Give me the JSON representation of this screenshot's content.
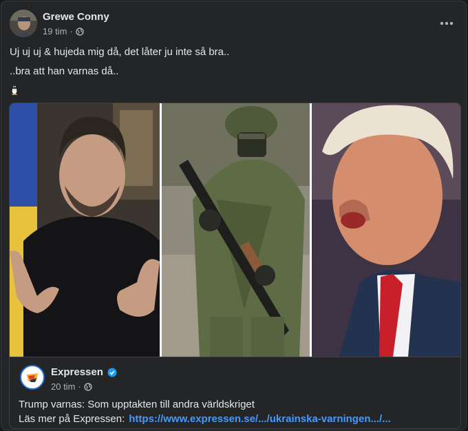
{
  "post": {
    "author": "Grewe Conny",
    "time": "19 tim",
    "separator": "·",
    "lines": [
      "Uj uj uj & hujeda mig då, det låter ju inte så bra..",
      "..bra att han varnas då.."
    ]
  },
  "link_card": {
    "source_name": "Expressen",
    "time": "20 tim",
    "separator": "·",
    "headline": "Trump varnas: Som upptakten till andra världskriget",
    "read_more_label": "Läs mer på Expressen:",
    "url": "https://www.expressen.se/.../ukrainska-varningen.../..."
  },
  "icons": {
    "privacy": "globe-icon",
    "menu": "more-options-icon",
    "emoji": "penguin-icon",
    "verified": "verified-badge-icon"
  },
  "colors": {
    "card_background": "#242526",
    "text": "#e4e6eb",
    "secondary_text": "#b0b3b8",
    "link": "#4599ff",
    "verified": "#1d9bf0"
  }
}
